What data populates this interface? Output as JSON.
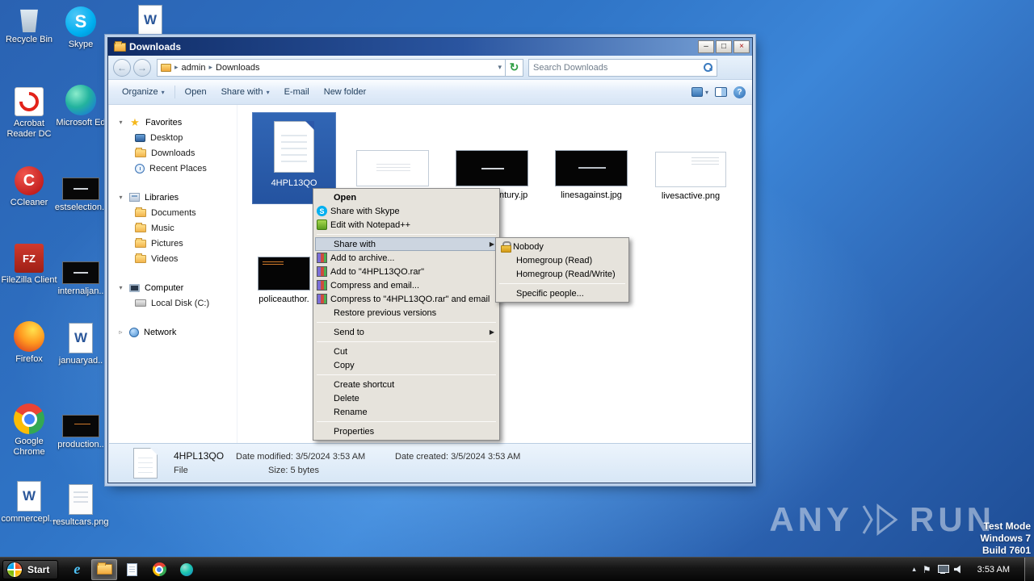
{
  "desktop": {
    "icons": [
      {
        "name": "recycle-bin",
        "label": "Recycle Bin"
      },
      {
        "name": "skype",
        "label": "Skype"
      },
      {
        "name": "word-doc",
        "label": ""
      },
      {
        "name": "acrobat",
        "label": "Acrobat Reader DC"
      },
      {
        "name": "edge",
        "label": "Microsoft Ed"
      },
      {
        "name": "ccleaner",
        "label": "CCleaner"
      },
      {
        "name": "estselection",
        "label": "estselection.."
      },
      {
        "name": "filezilla",
        "label": "FileZilla Client"
      },
      {
        "name": "internaljan",
        "label": "internaljan.."
      },
      {
        "name": "firefox",
        "label": "Firefox"
      },
      {
        "name": "januaryad",
        "label": "januaryad.."
      },
      {
        "name": "chrome",
        "label": "Google Chrome"
      },
      {
        "name": "production",
        "label": "production.."
      },
      {
        "name": "commercepl",
        "label": "commercepl..."
      },
      {
        "name": "resultcars",
        "label": "resultcars.png"
      }
    ]
  },
  "window": {
    "title": "Downloads",
    "controls": {
      "minimize": "–",
      "maximize": "□",
      "close": "×"
    },
    "nav": {
      "address_user": "admin",
      "address_folder": "Downloads",
      "search_placeholder": "Search Downloads"
    },
    "toolbar": {
      "items": [
        {
          "label": "Organize",
          "caret": true
        },
        {
          "label": "Open",
          "caret": false
        },
        {
          "label": "Share with",
          "caret": true
        },
        {
          "label": "E-mail",
          "caret": false
        },
        {
          "label": "New folder",
          "caret": false
        }
      ]
    },
    "sidebar": {
      "groups": [
        {
          "label": "Favorites",
          "icon": "favorites",
          "expanded": true,
          "items": [
            {
              "label": "Desktop",
              "icon": "desktop"
            },
            {
              "label": "Downloads",
              "icon": "downloads"
            },
            {
              "label": "Recent Places",
              "icon": "recent"
            }
          ]
        },
        {
          "label": "Libraries",
          "icon": "libraries",
          "expanded": true,
          "items": [
            {
              "label": "Documents",
              "icon": "folder"
            },
            {
              "label": "Music",
              "icon": "folder"
            },
            {
              "label": "Pictures",
              "icon": "folder"
            },
            {
              "label": "Videos",
              "icon": "folder"
            }
          ]
        },
        {
          "label": "Computer",
          "icon": "computer",
          "expanded": true,
          "items": [
            {
              "label": "Local Disk (C:)",
              "icon": "disk"
            }
          ]
        },
        {
          "label": "Network",
          "icon": "network",
          "expanded": false,
          "items": []
        }
      ]
    },
    "files": [
      {
        "label": "4HPL13QO",
        "type": "doc",
        "selected": true
      },
      {
        "label": "",
        "type": "white",
        "selected": false
      },
      {
        "label": "ntury.jp",
        "type": "black",
        "selected": false
      },
      {
        "label": "linesagainst.jpg",
        "type": "black",
        "selected": false
      },
      {
        "label": "livesactive.png",
        "type": "white",
        "selected": false
      },
      {
        "label": "policeauthor.",
        "type": "black",
        "selected": false
      }
    ],
    "details": {
      "name": "4HPL13QO",
      "date_modified": "Date modified: 3/5/2024 3:53 AM",
      "date_created": "Date created: 3/5/2024 3:53 AM",
      "type": "File",
      "size": "Size: 5 bytes"
    }
  },
  "context_menu": {
    "items": [
      {
        "label": "Open",
        "bold": true
      },
      {
        "label": "Share with Skype",
        "icon": "skype"
      },
      {
        "label": "Edit with Notepad++",
        "icon": "npp"
      },
      {
        "sep": true
      },
      {
        "label": "Share with",
        "submenu": true,
        "highlight": true
      },
      {
        "label": "Add to archive...",
        "icon": "winrar"
      },
      {
        "label": "Add to \"4HPL13QO.rar\"",
        "icon": "winrar"
      },
      {
        "label": "Compress and email...",
        "icon": "winrar"
      },
      {
        "label": "Compress to \"4HPL13QO.rar\" and email",
        "icon": "winrar"
      },
      {
        "label": "Restore previous versions"
      },
      {
        "sep": true
      },
      {
        "label": "Send to",
        "submenu": true
      },
      {
        "sep": true
      },
      {
        "label": "Cut"
      },
      {
        "label": "Copy"
      },
      {
        "sep": true
      },
      {
        "label": "Create shortcut"
      },
      {
        "label": "Delete"
      },
      {
        "label": "Rename"
      },
      {
        "sep": true
      },
      {
        "label": "Properties"
      }
    ]
  },
  "share_submenu": {
    "items": [
      {
        "label": "Nobody",
        "icon": "lock"
      },
      {
        "label": "Homegroup (Read)"
      },
      {
        "label": "Homegroup (Read/Write)"
      },
      {
        "sep": true
      },
      {
        "label": "Specific people..."
      }
    ]
  },
  "taskbar": {
    "start_label": "Start",
    "clock": "3:53 AM",
    "icons": [
      {
        "name": "ie",
        "active": false
      },
      {
        "name": "explorer",
        "active": true
      },
      {
        "name": "notepad",
        "active": false
      },
      {
        "name": "chrome",
        "active": false
      },
      {
        "name": "edge",
        "active": false
      }
    ]
  },
  "watermark": {
    "brand_left": "ANY",
    "brand_right": "RUN",
    "line1": "Test Mode",
    "line2": "Windows 7",
    "line3": "Build 7601"
  }
}
